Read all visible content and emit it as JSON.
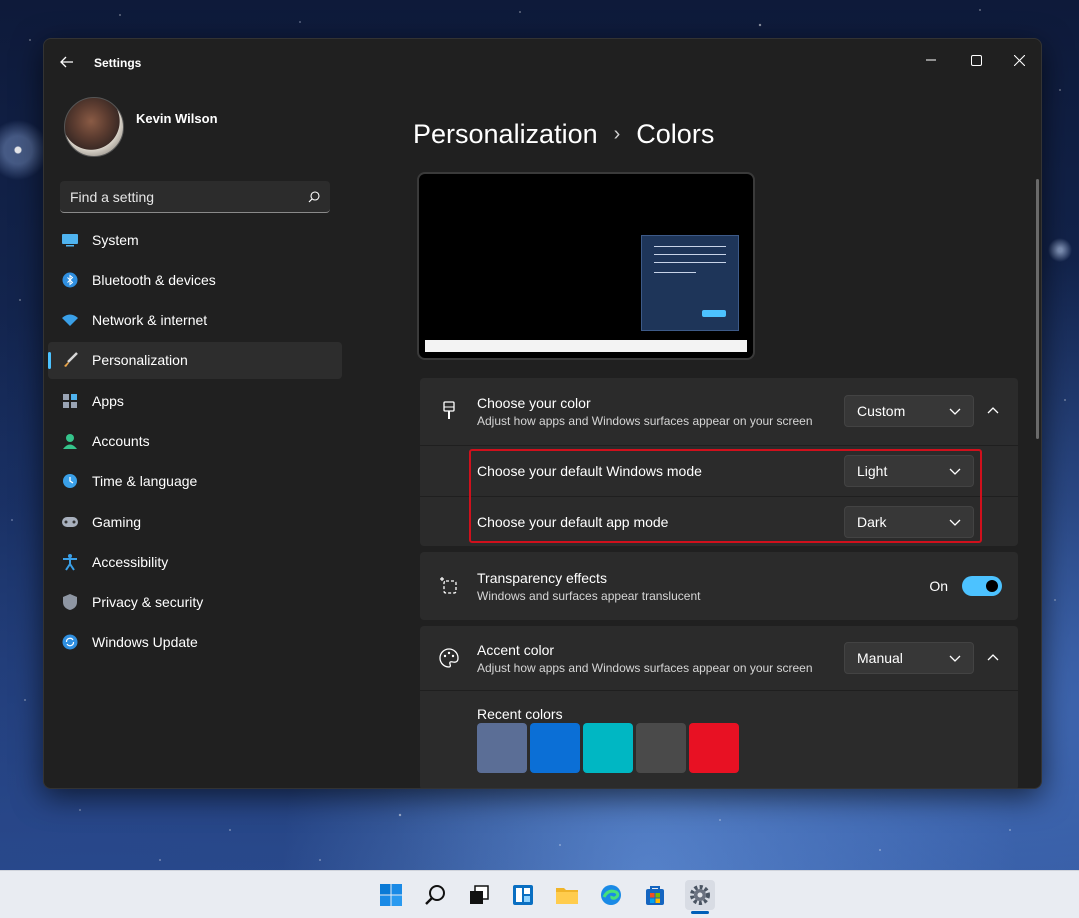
{
  "window": {
    "title": "Settings",
    "controls": {
      "minimize": "minimize-icon",
      "maximize": "maximize-icon",
      "close": "close-icon"
    }
  },
  "profile": {
    "name": "Kevin Wilson"
  },
  "search": {
    "placeholder": "Find a setting"
  },
  "sidebar": {
    "items": [
      {
        "label": "System",
        "icon": "system-icon"
      },
      {
        "label": "Bluetooth & devices",
        "icon": "bluetooth-icon"
      },
      {
        "label": "Network & internet",
        "icon": "wifi-icon"
      },
      {
        "label": "Personalization",
        "icon": "brush-icon",
        "active": true
      },
      {
        "label": "Apps",
        "icon": "apps-icon"
      },
      {
        "label": "Accounts",
        "icon": "accounts-icon"
      },
      {
        "label": "Time & language",
        "icon": "time-language-icon"
      },
      {
        "label": "Gaming",
        "icon": "gaming-icon"
      },
      {
        "label": "Accessibility",
        "icon": "accessibility-icon"
      },
      {
        "label": "Privacy & security",
        "icon": "shield-icon"
      },
      {
        "label": "Windows Update",
        "icon": "update-icon"
      }
    ]
  },
  "breadcrumb": {
    "parent": "Personalization",
    "separator": "›",
    "current": "Colors"
  },
  "choose_color": {
    "title": "Choose your color",
    "description": "Adjust how apps and Windows surfaces appear on your screen",
    "value": "Custom",
    "windows_mode": {
      "label": "Choose your default Windows mode",
      "value": "Light"
    },
    "app_mode": {
      "label": "Choose your default app mode",
      "value": "Dark"
    }
  },
  "transparency": {
    "title": "Transparency effects",
    "description": "Windows and surfaces appear translucent",
    "state_label": "On",
    "enabled": true
  },
  "accent": {
    "title": "Accent color",
    "description": "Adjust how apps and Windows surfaces appear on your screen",
    "value": "Manual",
    "recent_label": "Recent colors",
    "recent_colors": [
      "#5b6e96",
      "#0b6fd6",
      "#00b7c3",
      "#4a4a4a",
      "#e81123"
    ]
  },
  "colors": {
    "accent": "#4cc2ff",
    "highlight": "#d0101c",
    "window_bg": "#202020",
    "card_bg": "#2b2b2b"
  },
  "taskbar": {
    "icons": [
      "start-icon",
      "search-icon",
      "task-view-icon",
      "widgets-icon",
      "file-explorer-icon",
      "edge-icon",
      "store-icon",
      "settings-icon"
    ],
    "active": "settings-icon"
  }
}
